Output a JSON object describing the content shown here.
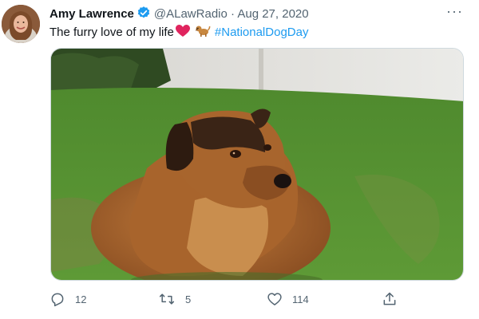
{
  "tweet": {
    "author_name": "Amy Lawrence",
    "handle": "@ALawRadio",
    "separator": "·",
    "date": "Aug 27, 2020",
    "text": "The furry love of my life",
    "hashtag": "#NationalDogDay",
    "emojis": [
      "heart-emoji",
      "dog-emoji"
    ],
    "more_label": "···"
  },
  "actions": {
    "reply_count": "12",
    "retweet_count": "5",
    "like_count": "114"
  },
  "colors": {
    "link": "#1d9bf0",
    "verified": "#1d9bf0",
    "muted": "#536471",
    "heart": "#e0245e"
  },
  "icons": [
    "reply-icon",
    "retweet-icon",
    "like-icon",
    "share-icon",
    "verified-badge-icon",
    "more-icon"
  ]
}
